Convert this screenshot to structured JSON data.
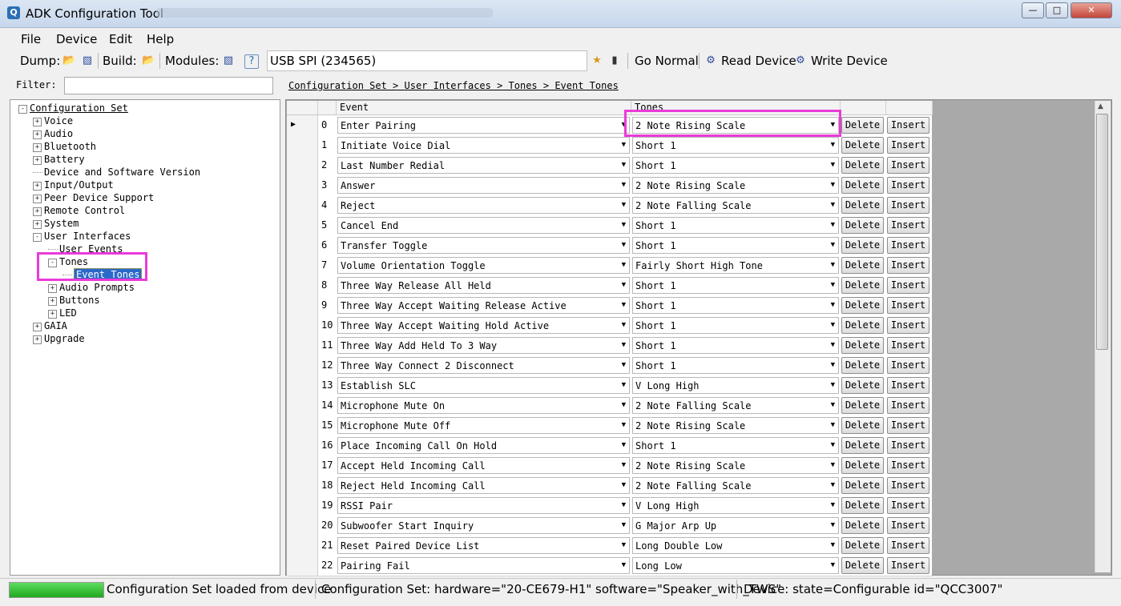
{
  "window": {
    "title": "ADK Configuration Tool"
  },
  "menu": [
    "File",
    "Device",
    "Edit",
    "Help"
  ],
  "toolbar": {
    "dump_label": "Dump:",
    "build_label": "Build:",
    "modules_label": "Modules:",
    "connection": "USB SPI (234565)",
    "go_normal": "Go Normal",
    "read_device": "Read Device",
    "write_device": "Write Device"
  },
  "filter": {
    "label": "Filter:",
    "value": ""
  },
  "breadcrumb": "Configuration Set > User Interfaces > Tones > Event Tones",
  "tree": [
    {
      "label": "Configuration Set",
      "level": 0,
      "expander": "-"
    },
    {
      "label": "Voice",
      "level": 1,
      "expander": "+"
    },
    {
      "label": "Audio",
      "level": 1,
      "expander": "+"
    },
    {
      "label": "Bluetooth",
      "level": 1,
      "expander": "+"
    },
    {
      "label": "Battery",
      "level": 1,
      "expander": "+"
    },
    {
      "label": "Device and Software Version",
      "level": 1,
      "expander": ""
    },
    {
      "label": "Input/Output",
      "level": 1,
      "expander": "+"
    },
    {
      "label": "Peer Device Support",
      "level": 1,
      "expander": "+"
    },
    {
      "label": "Remote Control",
      "level": 1,
      "expander": "+"
    },
    {
      "label": "System",
      "level": 1,
      "expander": "+"
    },
    {
      "label": "User Interfaces",
      "level": 1,
      "expander": "-"
    },
    {
      "label": "User Events",
      "level": 2,
      "expander": ""
    },
    {
      "label": "Tones",
      "level": 2,
      "expander": "-"
    },
    {
      "label": "Event Tones",
      "level": 3,
      "expander": "",
      "selected": true
    },
    {
      "label": "Audio Prompts",
      "level": 2,
      "expander": "+"
    },
    {
      "label": "Buttons",
      "level": 2,
      "expander": "+"
    },
    {
      "label": "LED",
      "level": 2,
      "expander": "+"
    },
    {
      "label": "GAIA",
      "level": 1,
      "expander": "+"
    },
    {
      "label": "Upgrade",
      "level": 1,
      "expander": "+"
    }
  ],
  "grid": {
    "headers": {
      "event": "Event",
      "tones": "Tones"
    },
    "delete_label": "Delete",
    "insert_label": "Insert",
    "rows": [
      {
        "index": "0",
        "event": "Enter Pairing",
        "tone": "2 Note Rising Scale"
      },
      {
        "index": "1",
        "event": "Initiate Voice Dial",
        "tone": "Short 1"
      },
      {
        "index": "2",
        "event": "Last Number Redial",
        "tone": "Short 1"
      },
      {
        "index": "3",
        "event": "Answer",
        "tone": "2 Note Rising Scale"
      },
      {
        "index": "4",
        "event": "Reject",
        "tone": "2 Note Falling Scale"
      },
      {
        "index": "5",
        "event": "Cancel End",
        "tone": "Short 1"
      },
      {
        "index": "6",
        "event": "Transfer Toggle",
        "tone": "Short 1"
      },
      {
        "index": "7",
        "event": "Volume Orientation Toggle",
        "tone": "Fairly Short High Tone"
      },
      {
        "index": "8",
        "event": "Three Way Release All Held",
        "tone": "Short 1"
      },
      {
        "index": "9",
        "event": "Three Way Accept Waiting Release Active",
        "tone": "Short 1"
      },
      {
        "index": "10",
        "event": "Three Way Accept Waiting Hold Active",
        "tone": "Short 1"
      },
      {
        "index": "11",
        "event": "Three Way Add Held To 3 Way",
        "tone": "Short 1"
      },
      {
        "index": "12",
        "event": "Three Way Connect 2 Disconnect",
        "tone": "Short 1"
      },
      {
        "index": "13",
        "event": "Establish SLC",
        "tone": "V Long High"
      },
      {
        "index": "14",
        "event": "Microphone Mute On",
        "tone": "2 Note Falling Scale"
      },
      {
        "index": "15",
        "event": "Microphone Mute Off",
        "tone": "2 Note Rising Scale"
      },
      {
        "index": "16",
        "event": "Place Incoming Call On Hold",
        "tone": "Short 1"
      },
      {
        "index": "17",
        "event": "Accept Held Incoming Call",
        "tone": "2 Note Rising Scale"
      },
      {
        "index": "18",
        "event": "Reject Held Incoming Call",
        "tone": "2 Note Falling Scale"
      },
      {
        "index": "19",
        "event": "RSSI Pair",
        "tone": "V Long High"
      },
      {
        "index": "20",
        "event": "Subwoofer Start Inquiry",
        "tone": "G Major Arp Up"
      },
      {
        "index": "21",
        "event": "Reset Paired Device List",
        "tone": "Long Double Low"
      },
      {
        "index": "22",
        "event": "Pairing Fail",
        "tone": "Long Low"
      }
    ]
  },
  "status": {
    "progress": 1.0,
    "message": "Configuration Set loaded from device",
    "config": "Configuration Set:  hardware=\"20-CE679-H1\" software=\"Speaker_with_TWS\"",
    "device": "Device:  state=Configurable id=\"QCC3007\""
  },
  "colors": {
    "highlight": "#ea3bd8",
    "selection": "#2a68c9",
    "progress": "#1ea81e"
  }
}
